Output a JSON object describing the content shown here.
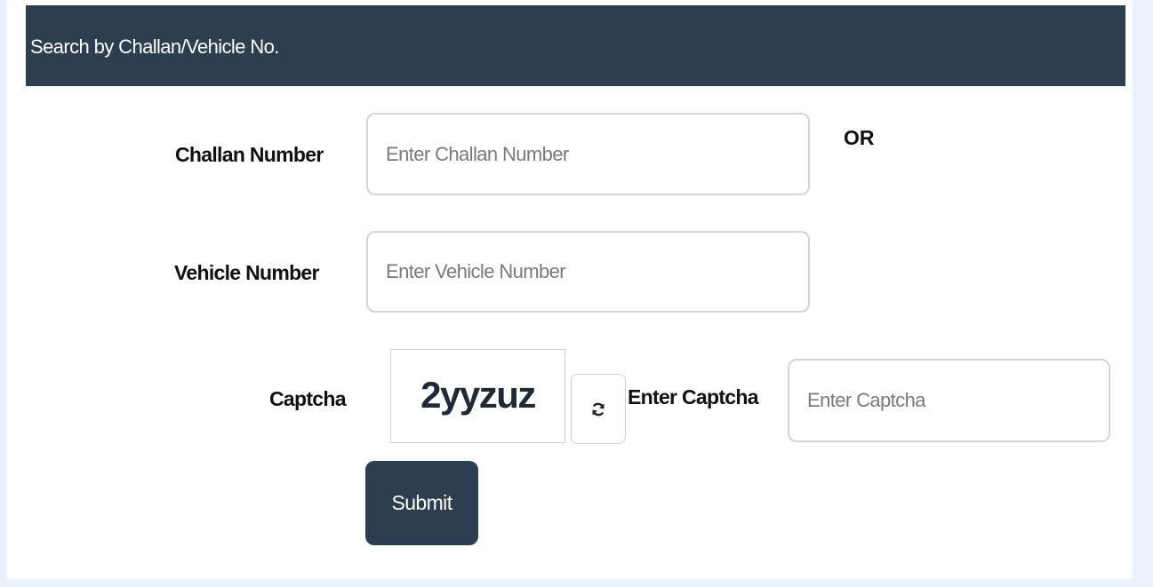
{
  "header": {
    "title": "Search by Challan/Vehicle No."
  },
  "form": {
    "challan_label": "Challan Number",
    "challan_placeholder": "Enter Challan Number",
    "or_text": "OR",
    "vehicle_label": "Vehicle Number",
    "vehicle_placeholder": "Enter Vehicle Number",
    "captcha_label": "Captcha",
    "captcha_value": "2yyzuz",
    "enter_captcha_label": "Enter Captcha",
    "enter_captcha_placeholder": "Enter Captcha",
    "submit_label": "Submit"
  },
  "icons": {
    "refresh": "refresh-icon"
  },
  "colors": {
    "header_bg": "#2c3e50",
    "button_bg": "#2c3e50",
    "page_bg": "#eaf3fd"
  }
}
